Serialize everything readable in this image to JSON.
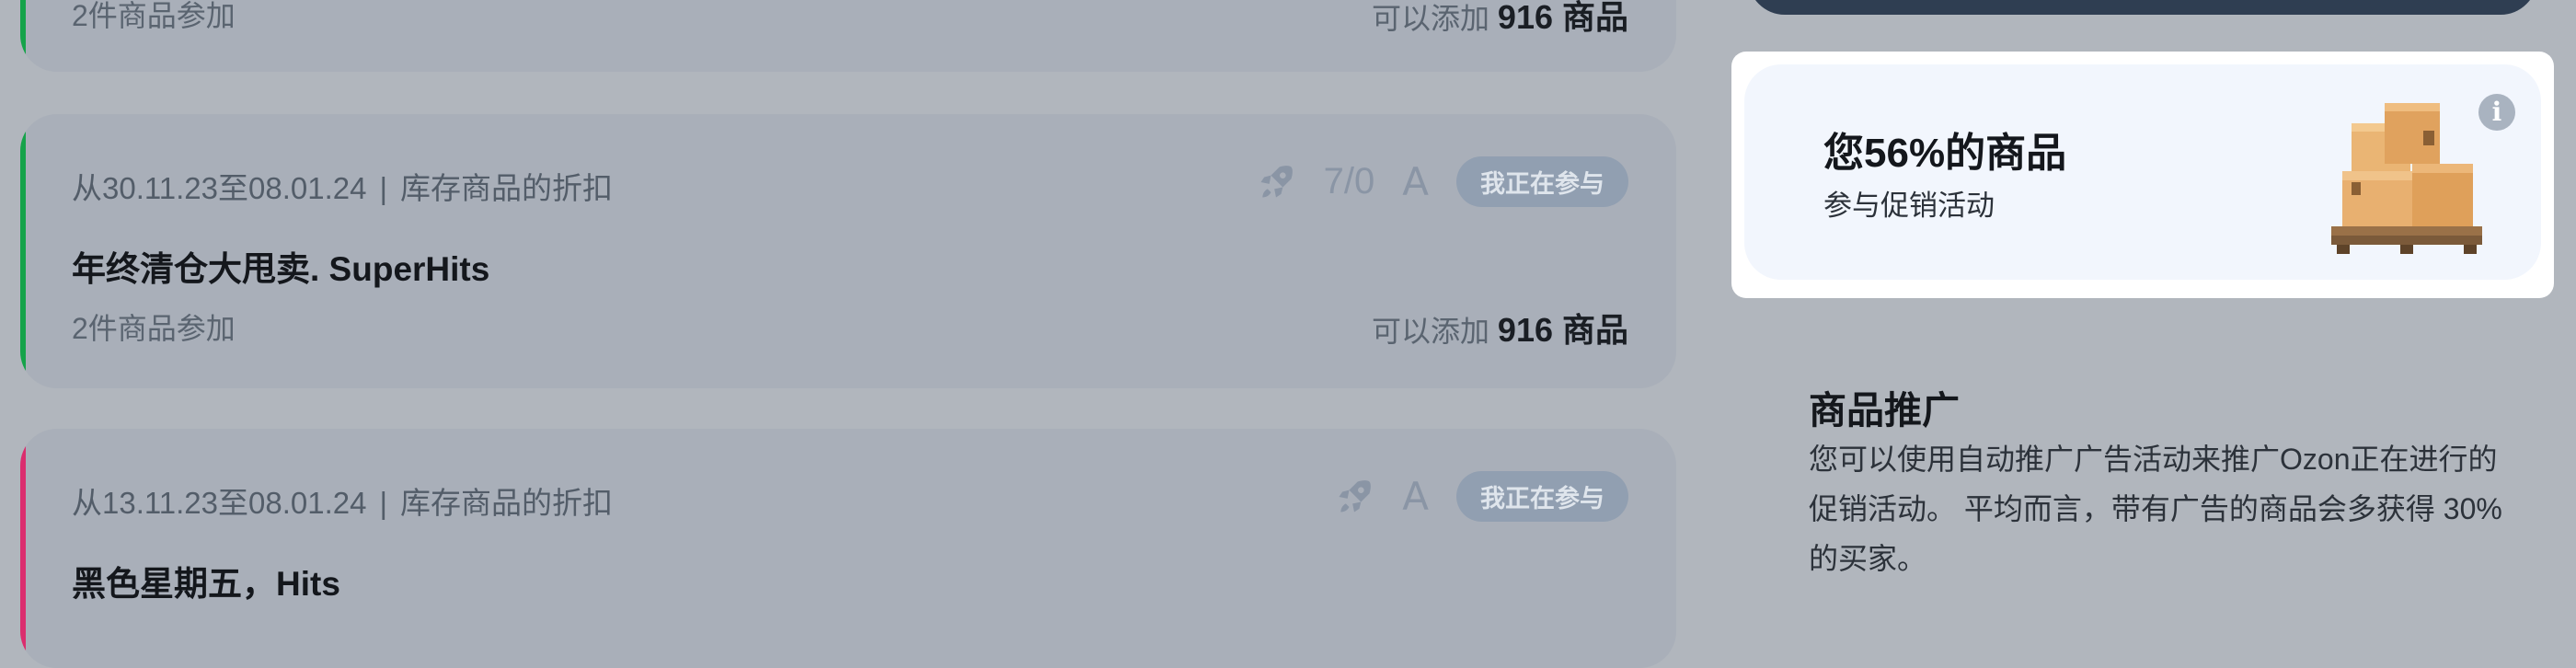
{
  "colors": {
    "page_bg": "#b1b6bd",
    "card_bg": "#a9afb9",
    "stripe_green": "#16a34a",
    "stripe_pink": "#db2d6e",
    "badge_bg": "#919fb1",
    "promo_bg": "#f2f6fd"
  },
  "promotions": [
    {
      "count": "2件商品参加",
      "add_prefix": "可以添加",
      "add_value": "916 商品"
    },
    {
      "date_range": "从30.11.23至08.01.24",
      "separator": "|",
      "type": "库存商品的折扣",
      "ratio": "7/0",
      "letter": "A",
      "badge": "我正在参与",
      "title": "年终清仓大甩卖. SuperHits",
      "count": "2件商品参加",
      "add_prefix": "可以添加",
      "add_value": "916 商品"
    },
    {
      "date_range": "从13.11.23至08.01.24",
      "separator": "|",
      "type": "库存商品的折扣",
      "letter": "A",
      "badge": "我正在参与",
      "title": "黑色星期五，Hits"
    }
  ],
  "summary": {
    "title": "您56%的商品",
    "subtitle": "参与促销活动",
    "info_glyph": "i",
    "icons": [
      "boxes-pallet-icon",
      "info-icon"
    ]
  },
  "advertising": {
    "title": "商品推广",
    "text": "您可以使用自动推广广告活动来推广Ozon正在进行的促销活动。 平均而言，带有广告的商品会多获得 30% 的买家。"
  }
}
